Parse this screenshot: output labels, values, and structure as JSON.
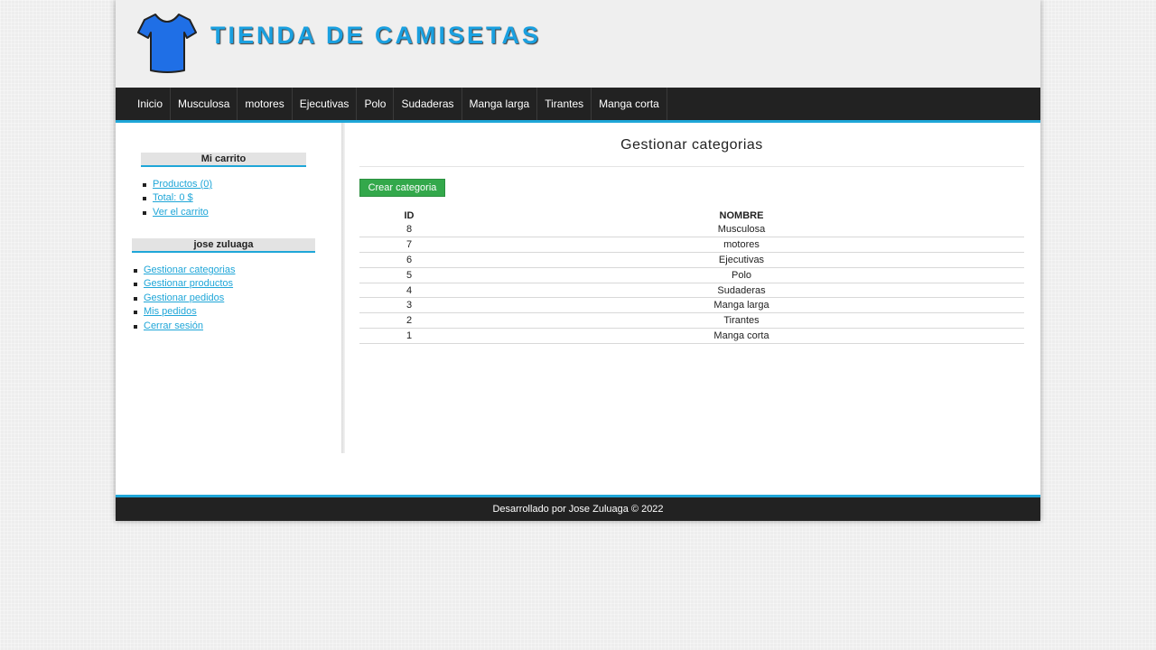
{
  "header": {
    "site_title": "TIENDA DE CAMISETAS",
    "logo_icon": "tshirt-icon",
    "accent_color": "#1aa0e0"
  },
  "menu": {
    "items": [
      {
        "label": "Inicio"
      },
      {
        "label": "Musculosa"
      },
      {
        "label": "motores"
      },
      {
        "label": "Ejecutivas"
      },
      {
        "label": "Polo"
      },
      {
        "label": "Sudaderas"
      },
      {
        "label": "Manga larga"
      },
      {
        "label": "Tirantes"
      },
      {
        "label": "Manga corta"
      }
    ]
  },
  "cart": {
    "title": "Mi carrito",
    "links": [
      {
        "label": "Productos (0)"
      },
      {
        "label": "Total: 0 $"
      },
      {
        "label": "Ver el carrito"
      }
    ]
  },
  "user": {
    "name": "jose zuluaga",
    "links": [
      {
        "label": "Gestionar categorias"
      },
      {
        "label": "Gestionar productos"
      },
      {
        "label": "Gestionar pedidos"
      },
      {
        "label": "Mis pedidos"
      },
      {
        "label": "Cerrar sesión"
      }
    ]
  },
  "main": {
    "title": "Gestionar categorias",
    "create_button": "Crear categoria",
    "table": {
      "headers": [
        "ID",
        "NOMBRE"
      ],
      "rows": [
        {
          "id": "8",
          "name": "Musculosa"
        },
        {
          "id": "7",
          "name": "motores"
        },
        {
          "id": "6",
          "name": "Ejecutivas"
        },
        {
          "id": "5",
          "name": "Polo"
        },
        {
          "id": "4",
          "name": "Sudaderas"
        },
        {
          "id": "3",
          "name": "Manga larga"
        },
        {
          "id": "2",
          "name": "Tirantes"
        },
        {
          "id": "1",
          "name": "Manga corta"
        }
      ]
    }
  },
  "footer": {
    "text": "Desarrollado por Jose Zuluaga © 2022"
  }
}
